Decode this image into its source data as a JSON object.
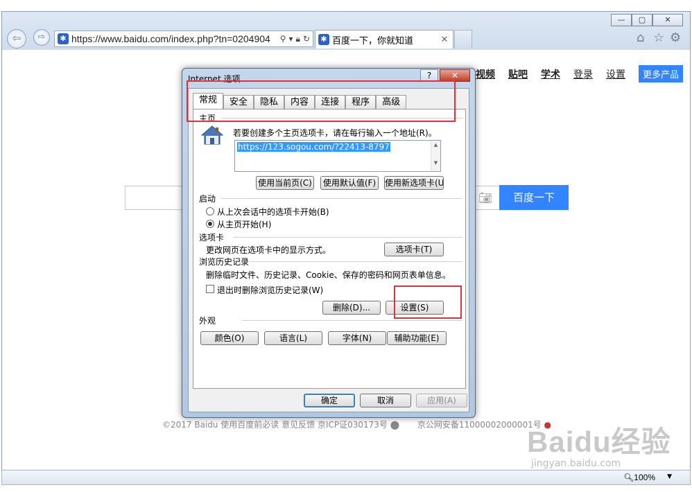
{
  "browser": {
    "window_controls": {
      "minimize": "—",
      "maximize": "▢",
      "close": "✕"
    },
    "address_url": "https://www.baidu.com/index.php?tn=0204904",
    "tab_title": "百度一下，你就知道",
    "tab_close": "✕",
    "zoom": "100%"
  },
  "baidu": {
    "nav": [
      "视频",
      "贴吧",
      "学术",
      "登录",
      "设置"
    ],
    "more_products": "更多产品",
    "search_button": "百度一下",
    "footer": {
      "copyright": "©2017 Baidu 使用百度前必读 意见反馈 京ICP证030173号",
      "police": "京公网安备11000002000001号"
    }
  },
  "watermark": {
    "big": "Baidu经验",
    "small": "jingyan.baidu.com"
  },
  "dialog": {
    "title": "Internet 选项",
    "help": "?",
    "close": "✕",
    "tabs": [
      "常规",
      "安全",
      "隐私",
      "内容",
      "连接",
      "程序",
      "高级"
    ],
    "active_tab": "常规",
    "homepage": {
      "label": "主页",
      "instruction": "若要创建多个主页选项卡，请在每行输入一个地址(R)。",
      "url": "https://123.sogou.com/?22413-8797",
      "buttons": [
        "使用当前页(C)",
        "使用默认值(F)",
        "使用新选项卡(U)"
      ]
    },
    "startup": {
      "label": "启动",
      "options": [
        "从上次会话中的选项卡开始(B)",
        "从主页开始(H)"
      ],
      "selected": "从主页开始(H)"
    },
    "tabs_section": {
      "label": "选项卡",
      "description": "更改网页在选项卡中的显示方式。",
      "button": "选项卡(T)"
    },
    "history": {
      "label": "浏览历史记录",
      "description": "删除临时文件、历史记录、Cookie、保存的密码和网页表单信息。",
      "checkbox": "退出时删除浏览历史记录(W)",
      "checked": false,
      "delete_button": "删除(D)...",
      "settings_button": "设置(S)"
    },
    "appearance": {
      "label": "外观",
      "buttons": [
        "颜色(O)",
        "语言(L)",
        "字体(N)",
        "辅助功能(E)"
      ]
    },
    "footer_buttons": {
      "ok": "确定",
      "cancel": "取消",
      "apply": "应用(A)"
    }
  }
}
